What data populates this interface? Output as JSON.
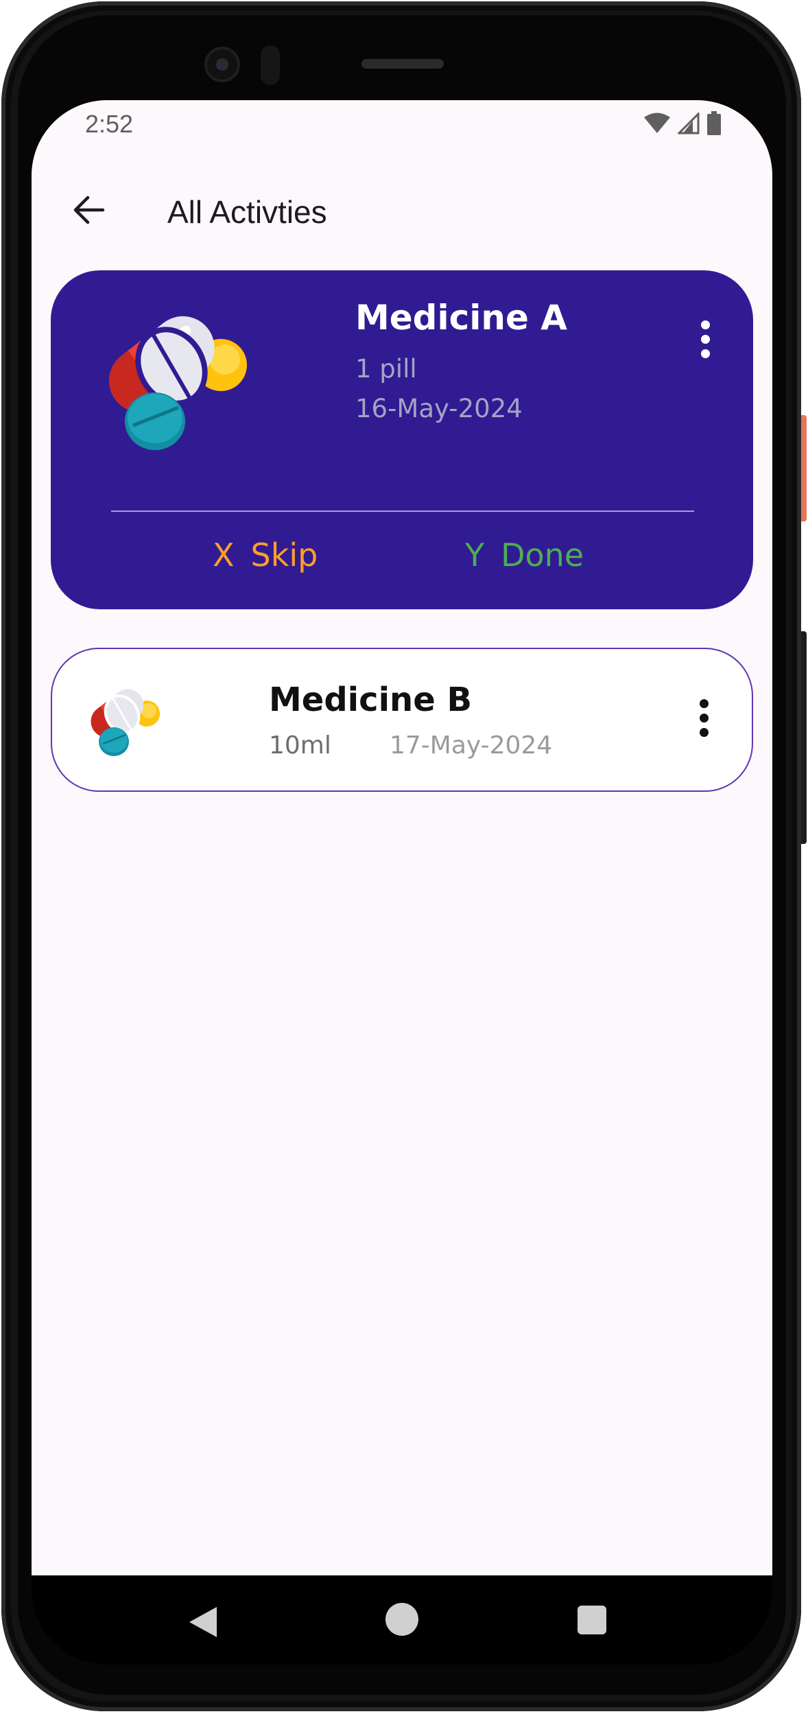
{
  "status": {
    "time": "2:52",
    "icons": [
      "wifi-icon",
      "signal-icon",
      "battery-icon"
    ]
  },
  "header": {
    "title": "All Activties",
    "back_icon": "arrow-left-icon"
  },
  "activities": [
    {
      "name": "Medicine A",
      "dose": "1 pill",
      "date": "16-May-2024",
      "expanded": true,
      "actions": {
        "skip_icon": "X",
        "skip_label": "Skip",
        "done_icon": "Y",
        "done_label": "Done"
      }
    },
    {
      "name": "Medicine B",
      "dose": "10ml",
      "date": "17-May-2024",
      "expanded": false
    }
  ],
  "colors": {
    "card_active": "#311b92",
    "card_border": "#5e35b1",
    "skip": "#ff9e29",
    "done": "#4caf50",
    "background": "#fdf8fc"
  },
  "navigation": {
    "buttons": [
      "nav-back-icon",
      "nav-home-icon",
      "nav-recents-icon"
    ]
  }
}
